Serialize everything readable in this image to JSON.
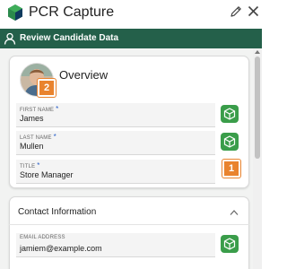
{
  "header": {
    "app_title": "PCR Capture",
    "icons": [
      "cube-logo",
      "pencil-icon",
      "close-icon"
    ]
  },
  "banner": {
    "title": "Review Candidate Data",
    "background": "#24604a",
    "icon": "user-icon"
  },
  "overview": {
    "title": "Overview",
    "avatar_badge": "2",
    "fields": [
      {
        "label": "FIRST NAME",
        "required_mark": "*",
        "value": "James",
        "action_icon": "cube-icon"
      },
      {
        "label": "LAST NAME",
        "required_mark": "*",
        "value": "Mullen",
        "action_icon": "cube-icon"
      },
      {
        "label": "TITLE",
        "required_mark": "*",
        "value": "Store Manager",
        "action_badge": "1"
      }
    ]
  },
  "contact": {
    "title": "Contact Information",
    "fields": [
      {
        "label": "EMAIL ADDRESS",
        "value": "jamiem@example.com",
        "action_icon": "cube-icon"
      }
    ]
  },
  "colors": {
    "accent_green": "#3a9d4a",
    "badge_orange": "#e9832e",
    "required_star": "#2a60c8"
  }
}
